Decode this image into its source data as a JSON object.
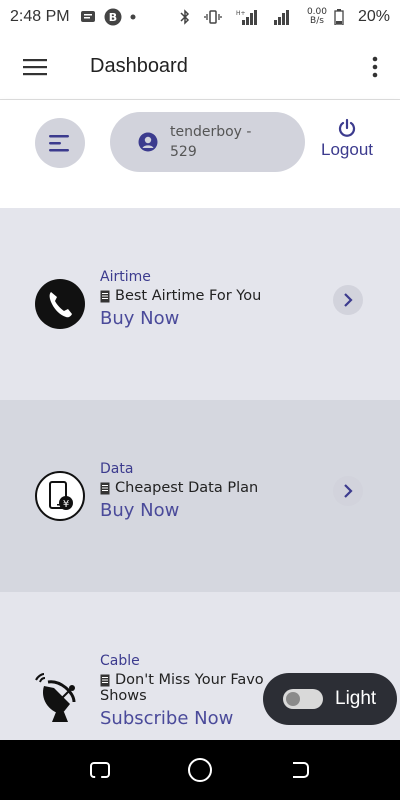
{
  "status_bar": {
    "time": "2:48 PM",
    "network_speed_value": "0.00",
    "network_speed_unit": "B/s",
    "battery": "20%"
  },
  "app_bar": {
    "title": "Dashboard"
  },
  "user": {
    "username": "tenderboy - 529",
    "logout_label": "Logout"
  },
  "services": [
    {
      "category": "Airtime",
      "description": "Best Airtime For You",
      "cta": "Buy Now",
      "icon": "phone-icon"
    },
    {
      "category": "Data",
      "description": "Cheapest Data Plan",
      "cta": "Buy Now",
      "icon": "mobile-data-icon"
    },
    {
      "category": "Cable",
      "description": "Don't Miss Your Favo",
      "description_line2": "Shows",
      "cta": "Subscribe Now",
      "icon": "satellite-dish-icon"
    }
  ],
  "theme_toggle": {
    "label": "Light"
  },
  "colors": {
    "accent": "#3c3b8e",
    "background": "#e4e5ec",
    "highlight_row": "#d5d7df"
  }
}
